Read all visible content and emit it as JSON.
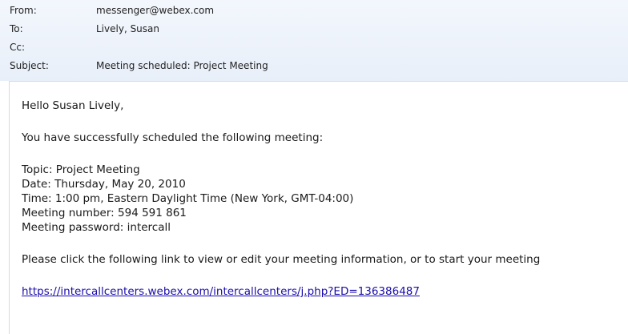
{
  "header": {
    "from_label": "From:",
    "from_value": "messenger@webex.com",
    "to_label": "To:",
    "to_value": "Lively, Susan",
    "cc_label": "Cc:",
    "cc_value": "",
    "subject_label": "Subject:",
    "subject_value": "Meeting scheduled: Project Meeting"
  },
  "body": {
    "greeting": "Hello Susan Lively,",
    "intro": "You have successfully scheduled the following meeting:",
    "topic": "Topic: Project Meeting",
    "date": "Date: Thursday, May 20, 2010",
    "time": "Time: 1:00 pm, Eastern Daylight Time (New York, GMT-04:00)",
    "meeting_number": "Meeting number: 594 591 861",
    "meeting_password": "Meeting password: intercall",
    "instructions": "Please click the following link to view or edit your meeting information, or to start your meeting",
    "link": "https://intercallcenters.webex.com/intercallcenters/j.php?ED=136386487"
  }
}
